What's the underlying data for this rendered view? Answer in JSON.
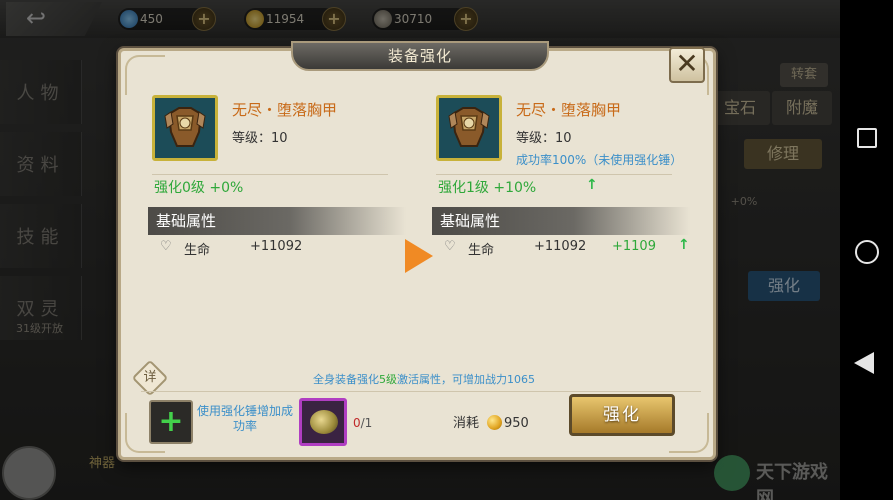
{
  "topbar": {
    "resources": [
      {
        "name": "diamond",
        "value": "450",
        "plus": "+"
      },
      {
        "name": "gold",
        "value": "11954",
        "plus": "+"
      },
      {
        "name": "power",
        "value": "30710",
        "plus": "+"
      }
    ]
  },
  "sidemenu": {
    "items": [
      {
        "label": "人物"
      },
      {
        "label": "资料"
      },
      {
        "label": "技能"
      },
      {
        "label": "双灵"
      }
    ],
    "note": "31级开放",
    "artifact_label": "神器"
  },
  "rightpanel": {
    "convert": "转套",
    "gem": "宝石",
    "enchant": "附魔",
    "repair": "修理",
    "enhance": "强化",
    "small_stat": "+0%"
  },
  "dialog": {
    "title": "装备强化",
    "close": "✕",
    "left": {
      "item_name": "无尽・堕落胸甲",
      "level": "等级：10",
      "enh_level": "强化0级  +0%",
      "base_header": "基础属性",
      "attr_name": "生命",
      "attr_value": "+11092"
    },
    "right": {
      "item_name": "无尽・堕落胸甲",
      "level": "等级：10",
      "success_rate": "成功率100%（未使用强化锤）",
      "enh_level": "强化1级  +10%",
      "base_header": "基础属性",
      "attr_name": "生命",
      "attr_value": "+11092",
      "attr_increase": "+1109"
    },
    "banner_pre": "全身装备强化",
    "banner_hl": "5级",
    "banner_post": "激活属性，可增加战力1065",
    "detail": "详",
    "add_hammer_text": "使用强化锤增加成功率",
    "hammer_count_used": "0",
    "hammer_count_rest": "/1",
    "cost_label": "消耗",
    "cost_value": "950",
    "enhance_button": "强化"
  },
  "watermark": "天下游戏网",
  "colors": {
    "item_name": "#c86a18",
    "success_green": "#2fa83a",
    "info_blue": "#3b8fc9",
    "arrow_orange": "#f08a24"
  }
}
